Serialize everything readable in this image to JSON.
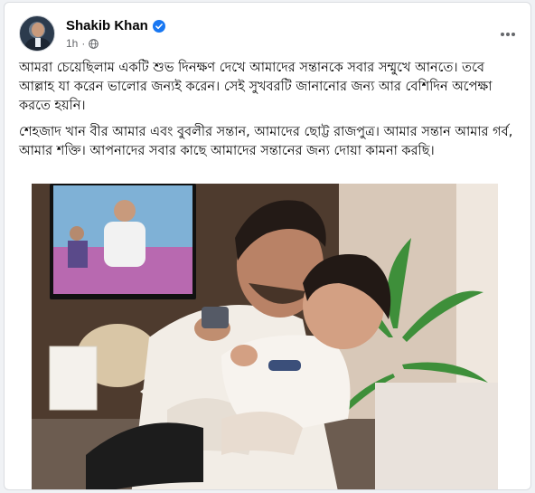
{
  "post": {
    "author": "Shakib Khan",
    "time": "1h",
    "paragraphs": [
      "আমরা চেয়েছিলাম একটি শুভ দিনক্ষণ দেখে আমাদের সন্তানকে সবার সম্মুখে আনতে। তবে আল্লাহ যা করেন ভালোর জন্যই করেন। সেই সুখবরটি জানানোর জন্য আর বেশিদিন অপেক্ষা করতে হয়নি।",
      "শেহজাদ খান বীর আমার এবং বুবলীর সন্তান, আমাদের ছোট্ট রাজপুত্র। আমার সন্তান আমার গর্ব, আমার শক্তি। আপনাদের সবার কাছে আমাদের সন্তানের জন্য দোয়া কামনা করছি।"
    ]
  },
  "icons": {
    "verified": "verified-badge-icon",
    "audience": "globe-icon",
    "more": "more-options-icon"
  },
  "colors": {
    "verified": "#1877f2",
    "meta_text": "#65676b",
    "card_bg": "#ffffff",
    "page_bg": "#f0f2f5"
  }
}
